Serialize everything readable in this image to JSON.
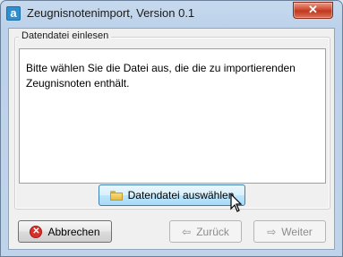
{
  "window": {
    "title": "Zeugnisnotenimport, Version 0.1",
    "app_icon_letter": "a",
    "close_glyph": "✕"
  },
  "group": {
    "legend": "Datendatei einlesen",
    "instruction": "Bitte wählen Sie die Datei aus, die die zu importierenden Zeugnisnoten enthält."
  },
  "buttons": {
    "select_file": "Datendatei auswählen",
    "cancel": "Abbrechen",
    "back": "Zurück",
    "next": "Weiter",
    "back_glyph": "⇦",
    "next_glyph": "⇨",
    "cancel_glyph": "✕"
  },
  "icons": {
    "app": "app-icon",
    "close": "close-icon",
    "folder": "folder-icon",
    "cancel": "cancel-icon",
    "back": "arrow-left-icon",
    "next": "arrow-right-icon",
    "cursor": "mouse-cursor-icon"
  },
  "colors": {
    "accent": "#2d8fd0",
    "close_button": "#c1381e",
    "cancel_icon": "#d9302a",
    "disabled_text": "#8c8c8c"
  }
}
